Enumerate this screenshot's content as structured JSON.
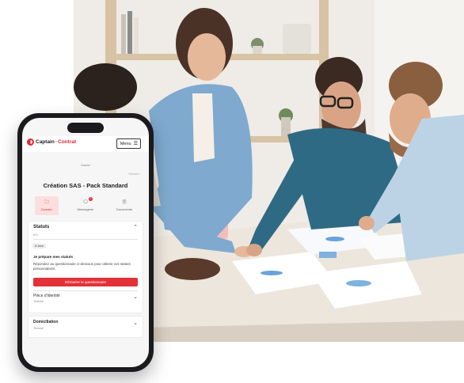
{
  "app": {
    "brand_first": "Captain",
    "brand_second": "Contrat",
    "menu_label": "Menu",
    "menu_icon": "hamburger-icon"
  },
  "card": {
    "breadcrumb": "Dossier",
    "next_label": "Suivant",
    "title": "Création SAS - Pack Standard"
  },
  "tabs": [
    {
      "label": "Dossier",
      "icon": "folder-icon",
      "active": true
    },
    {
      "label": "Messagerie",
      "icon": "chat-icon",
      "badge": "2"
    },
    {
      "label": "Documents",
      "icon": "document-icon"
    }
  ],
  "statuts": {
    "title": "Statuts",
    "count": "0/3",
    "badge": "À faire",
    "heading": "Je prépare mes statuts",
    "description": "Répondez au questionnaire ci-dessous pour obtenir vos statuts personnalisés.",
    "button": "Démarrer le questionnaire",
    "piece_title": "Pièce d'identité",
    "piece_status": "Terminé"
  },
  "domiciliation": {
    "title": "Domiciliation",
    "status": "Terminé"
  },
  "colors": {
    "accent": "#e23138",
    "active_tab_bg": "#fbdfdf",
    "phone_body": "#1b1b1d"
  }
}
